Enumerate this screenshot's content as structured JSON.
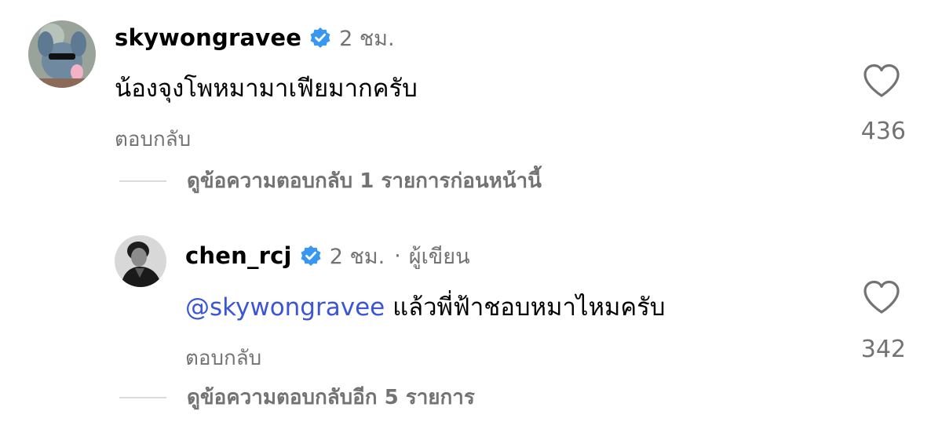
{
  "comments": [
    {
      "username": "skywongravee",
      "verified_icon": "verified-badge-icon",
      "time": "2 ชม.",
      "text": "น้องจุงโพหมามาเฟียมากครับ",
      "reply_label": "ตอบกลับ",
      "like_icon": "heart-outline-icon",
      "like_count": "436",
      "view_replies_label": "ดูข้อความตอบกลับ 1 รายการก่อนหน้านี้"
    },
    {
      "username": "chen_rcj",
      "verified_icon": "verified-badge-icon",
      "time": "2 ชม.",
      "separator": "·",
      "author_label": "ผู้เขียน",
      "mention": "@skywongravee",
      "text": "แล้วพี่ฟ้าชอบหมาไหมครับ",
      "reply_label": "ตอบกลับ",
      "like_icon": "heart-outline-icon",
      "like_count": "342",
      "view_replies_label": "ดูข้อความตอบกลับอีก 5 รายการ"
    }
  ],
  "colors": {
    "text_primary": "#000000",
    "text_secondary": "#737373",
    "mention": "#3b55d9",
    "verified": "#3897f0",
    "divider": "#dbdbdb"
  }
}
